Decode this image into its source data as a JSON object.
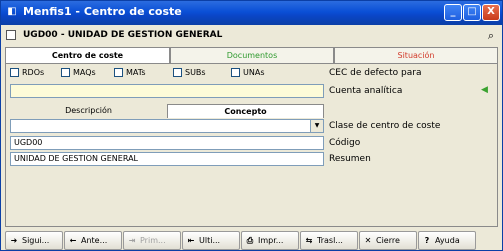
{
  "window": {
    "title": "Menfis1 - Centro de coste",
    "app_icon": "app-icon",
    "buttons": {
      "minimize": "_",
      "maximize": "□",
      "close": "X"
    }
  },
  "header": {
    "record_title": "UGD00 - UNIDAD DE GESTION GENERAL",
    "binoculars": "⌕"
  },
  "tabs": [
    {
      "label": "Centro de coste"
    },
    {
      "label": "Documentos"
    },
    {
      "label": "Situación"
    }
  ],
  "checkboxes": [
    {
      "label": "RDOs"
    },
    {
      "label": "MAQs"
    },
    {
      "label": "MATs"
    },
    {
      "label": "SUBs"
    },
    {
      "label": "UNAs"
    }
  ],
  "labels": {
    "cec_default": "CEC de defecto para",
    "analytic_account": "Cuenta analítica",
    "cost_center_class": "Clase de centro de coste",
    "code": "Código",
    "summary": "Resumen"
  },
  "subtabs": [
    {
      "label": "Descripción"
    },
    {
      "label": "Concepto"
    }
  ],
  "fields": {
    "analytic_account_value": "",
    "class_value": "",
    "code_value": "UGD00",
    "summary_value": "UNIDAD DE GESTION GENERAL"
  },
  "toolbar": [
    {
      "icon": "➜",
      "label": "Sigui...",
      "enabled": true
    },
    {
      "icon": "←",
      "label": "Ante...",
      "enabled": true
    },
    {
      "icon": "⇥",
      "label": "Prim...",
      "enabled": false
    },
    {
      "icon": "⇤",
      "label": "Ulti...",
      "enabled": true
    },
    {
      "icon": "⎙",
      "label": "Impr...",
      "enabled": true
    },
    {
      "icon": "⇆",
      "label": "Trasl...",
      "enabled": true
    },
    {
      "icon": "✕",
      "label": "Cierre",
      "enabled": true
    },
    {
      "icon": "?",
      "label": "Ayuda",
      "enabled": true
    }
  ]
}
